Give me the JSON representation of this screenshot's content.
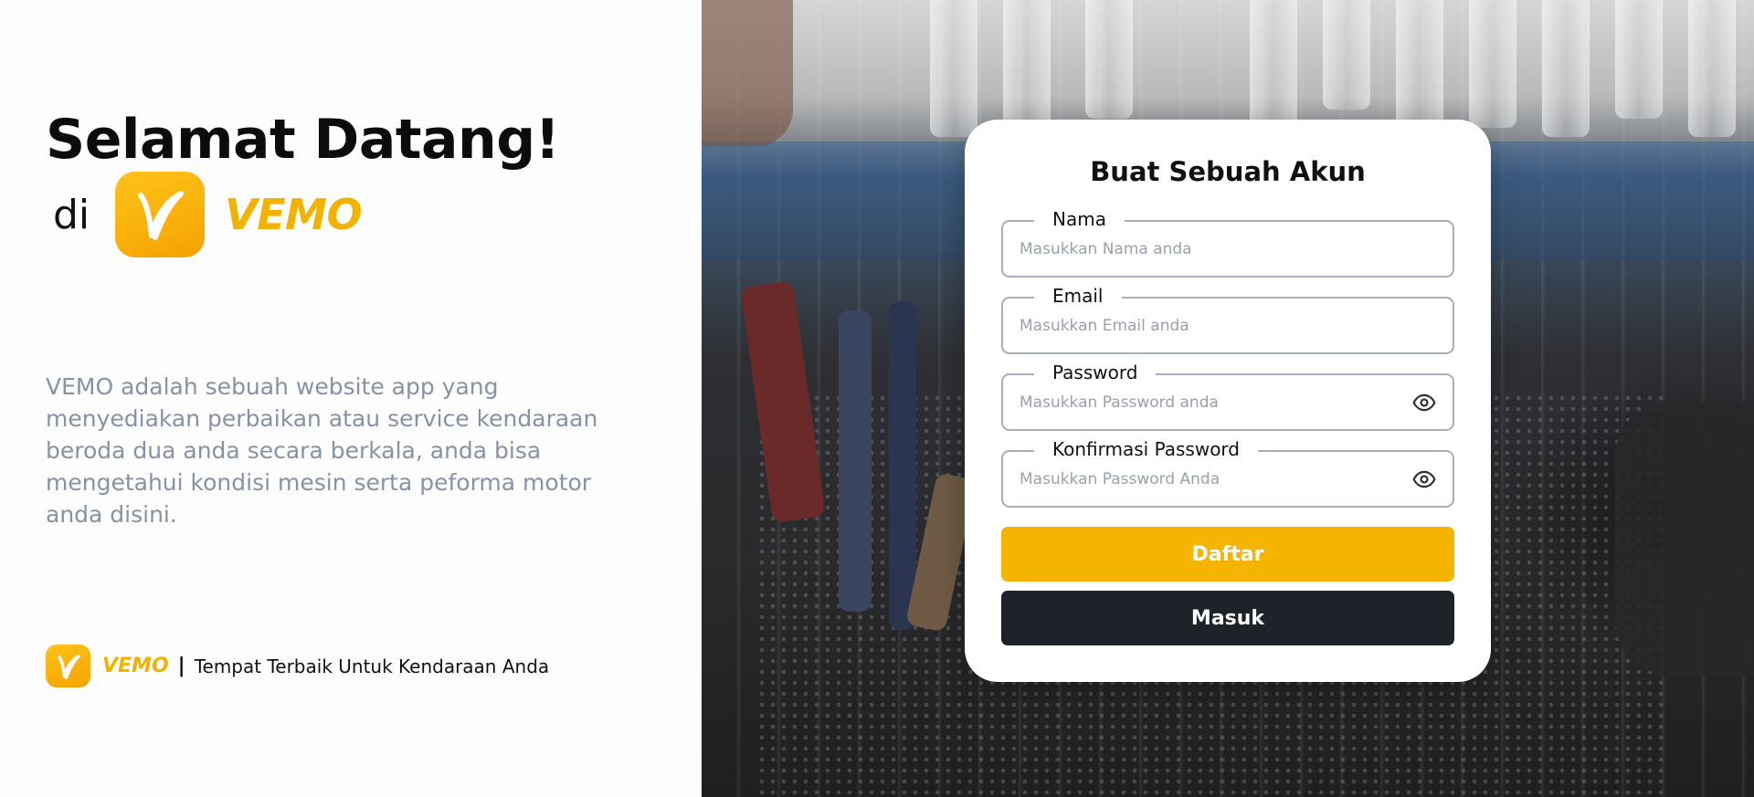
{
  "welcome": {
    "title": "Selamat Datang!",
    "prefix": "di",
    "brand_name": "VEMO"
  },
  "description": "VEMO adalah sebuah website app yang menyediakan perbaikan atau service kendaraan beroda dua anda secara berkala, anda bisa mengetahui kondisi mesin serta peforma motor anda disini.",
  "footer": {
    "brand_name": "VEMO",
    "separator": "|",
    "tagline": "Tempat Terbaik Untuk Kendaraan Anda"
  },
  "form": {
    "title": "Buat Sebuah Akun",
    "fields": {
      "name": {
        "label": "Nama",
        "value": "",
        "placeholder": "Masukkan Nama anda"
      },
      "email": {
        "label": "Email",
        "value": "",
        "placeholder": "Masukkan Email anda"
      },
      "password": {
        "label": "Password",
        "value": "",
        "placeholder": "Masukkan Password anda"
      },
      "confirm_password": {
        "label": "Konfirmasi Password",
        "value": "",
        "placeholder": "Masukkan Password Anda"
      }
    },
    "register_label": "Daftar",
    "login_label": "Masuk"
  },
  "icons": {
    "logo": "vemo-logo-icon",
    "password_toggle": "eye-icon"
  },
  "colors": {
    "brand_yellow": "#f5b400",
    "dark_button": "#1e2229",
    "description_text": "#8792a6",
    "input_border": "#a8adbf"
  }
}
